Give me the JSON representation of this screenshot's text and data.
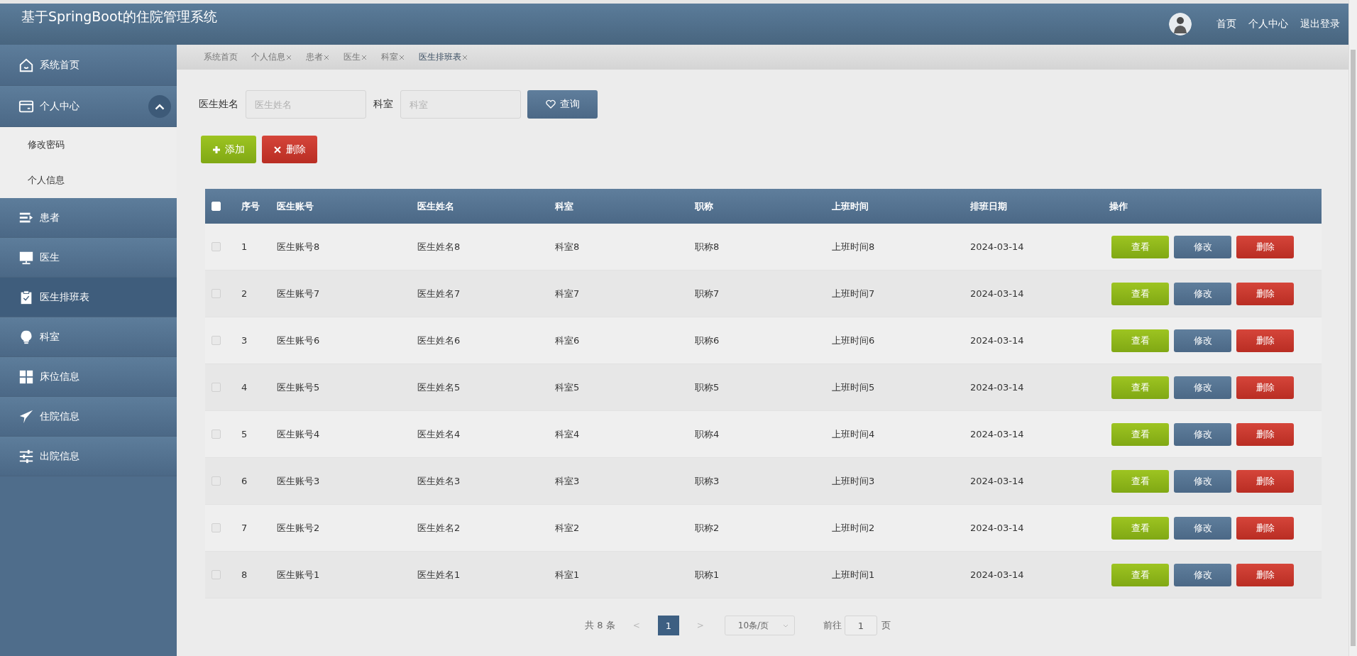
{
  "header": {
    "title": "基于SpringBoot的住院管理系统",
    "links": [
      "首页",
      "个人中心",
      "退出登录"
    ]
  },
  "sidebar": {
    "items": [
      {
        "label": "系统首页",
        "selected": false
      },
      {
        "label": "个人中心",
        "selected": false,
        "expanded": true,
        "children": [
          {
            "label": "修改密码",
            "selected": false
          },
          {
            "label": "个人信息",
            "selected": false
          }
        ]
      },
      {
        "label": "患者",
        "selected": false
      },
      {
        "label": "医生",
        "selected": false
      },
      {
        "label": "医生排班表",
        "selected": true
      },
      {
        "label": "科室",
        "selected": false
      },
      {
        "label": "床位信息",
        "selected": false
      },
      {
        "label": "住院信息",
        "selected": false
      },
      {
        "label": "出院信息",
        "selected": false
      }
    ]
  },
  "tabs": [
    {
      "label": "系统首页",
      "closable": false,
      "selected": false
    },
    {
      "label": "个人信息",
      "closable": true,
      "selected": false
    },
    {
      "label": "患者",
      "closable": true,
      "selected": false
    },
    {
      "label": "医生",
      "closable": true,
      "selected": false
    },
    {
      "label": "科室",
      "closable": true,
      "selected": false
    },
    {
      "label": "医生排班表",
      "closable": true,
      "selected": true
    }
  ],
  "search": {
    "fields": [
      {
        "label": "医生姓名",
        "placeholder": "医生姓名"
      },
      {
        "label": "科室",
        "placeholder": "科室"
      }
    ],
    "button": "查询"
  },
  "actions": [
    {
      "label": "添加",
      "kind": "add"
    },
    {
      "label": "删除",
      "kind": "delete"
    }
  ],
  "table": {
    "header_checked": false,
    "columns": [
      "序号",
      "医生账号",
      "医生姓名",
      "科室",
      "职称",
      "上班时间",
      "排班日期",
      "操作"
    ],
    "rows": [
      {
        "checked": false,
        "cells": [
          "1",
          "医生账号8",
          "医生姓名8",
          "科室8",
          "职称8",
          "上班时间8",
          "2024-03-14"
        ],
        "actions": [
          {
            "label": "查看",
            "kind": "view"
          },
          {
            "label": "修改",
            "kind": "edit"
          },
          {
            "label": "删除",
            "kind": "delete"
          }
        ]
      },
      {
        "checked": false,
        "cells": [
          "2",
          "医生账号7",
          "医生姓名7",
          "科室7",
          "职称7",
          "上班时间7",
          "2024-03-14"
        ],
        "actions": [
          {
            "label": "查看",
            "kind": "view"
          },
          {
            "label": "修改",
            "kind": "edit"
          },
          {
            "label": "删除",
            "kind": "delete"
          }
        ]
      },
      {
        "checked": false,
        "cells": [
          "3",
          "医生账号6",
          "医生姓名6",
          "科室6",
          "职称6",
          "上班时间6",
          "2024-03-14"
        ],
        "actions": [
          {
            "label": "查看",
            "kind": "view"
          },
          {
            "label": "修改",
            "kind": "edit"
          },
          {
            "label": "删除",
            "kind": "delete"
          }
        ]
      },
      {
        "checked": false,
        "cells": [
          "4",
          "医生账号5",
          "医生姓名5",
          "科室5",
          "职称5",
          "上班时间5",
          "2024-03-14"
        ],
        "actions": [
          {
            "label": "查看",
            "kind": "view"
          },
          {
            "label": "修改",
            "kind": "edit"
          },
          {
            "label": "删除",
            "kind": "delete"
          }
        ]
      },
      {
        "checked": false,
        "cells": [
          "5",
          "医生账号4",
          "医生姓名4",
          "科室4",
          "职称4",
          "上班时间4",
          "2024-03-14"
        ],
        "actions": [
          {
            "label": "查看",
            "kind": "view"
          },
          {
            "label": "修改",
            "kind": "edit"
          },
          {
            "label": "删除",
            "kind": "delete"
          }
        ]
      },
      {
        "checked": false,
        "cells": [
          "6",
          "医生账号3",
          "医生姓名3",
          "科室3",
          "职称3",
          "上班时间3",
          "2024-03-14"
        ],
        "actions": [
          {
            "label": "查看",
            "kind": "view"
          },
          {
            "label": "修改",
            "kind": "edit"
          },
          {
            "label": "删除",
            "kind": "delete"
          }
        ]
      },
      {
        "checked": false,
        "cells": [
          "7",
          "医生账号2",
          "医生姓名2",
          "科室2",
          "职称2",
          "上班时间2",
          "2024-03-14"
        ],
        "actions": [
          {
            "label": "查看",
            "kind": "view"
          },
          {
            "label": "修改",
            "kind": "edit"
          },
          {
            "label": "删除",
            "kind": "delete"
          }
        ]
      },
      {
        "checked": false,
        "cells": [
          "8",
          "医生账号1",
          "医生姓名1",
          "科室1",
          "职称1",
          "上班时间1",
          "2024-03-14"
        ],
        "actions": [
          {
            "label": "查看",
            "kind": "view"
          },
          {
            "label": "修改",
            "kind": "edit"
          },
          {
            "label": "删除",
            "kind": "delete"
          }
        ]
      }
    ]
  },
  "pagination": {
    "total": "共 8 条",
    "prev": "<",
    "pages": [
      {
        "label": "1",
        "selected": true
      }
    ],
    "next": ">",
    "page_size": "10条/页",
    "goto_label": "前往",
    "goto_value": "1",
    "page_unit": "页"
  }
}
